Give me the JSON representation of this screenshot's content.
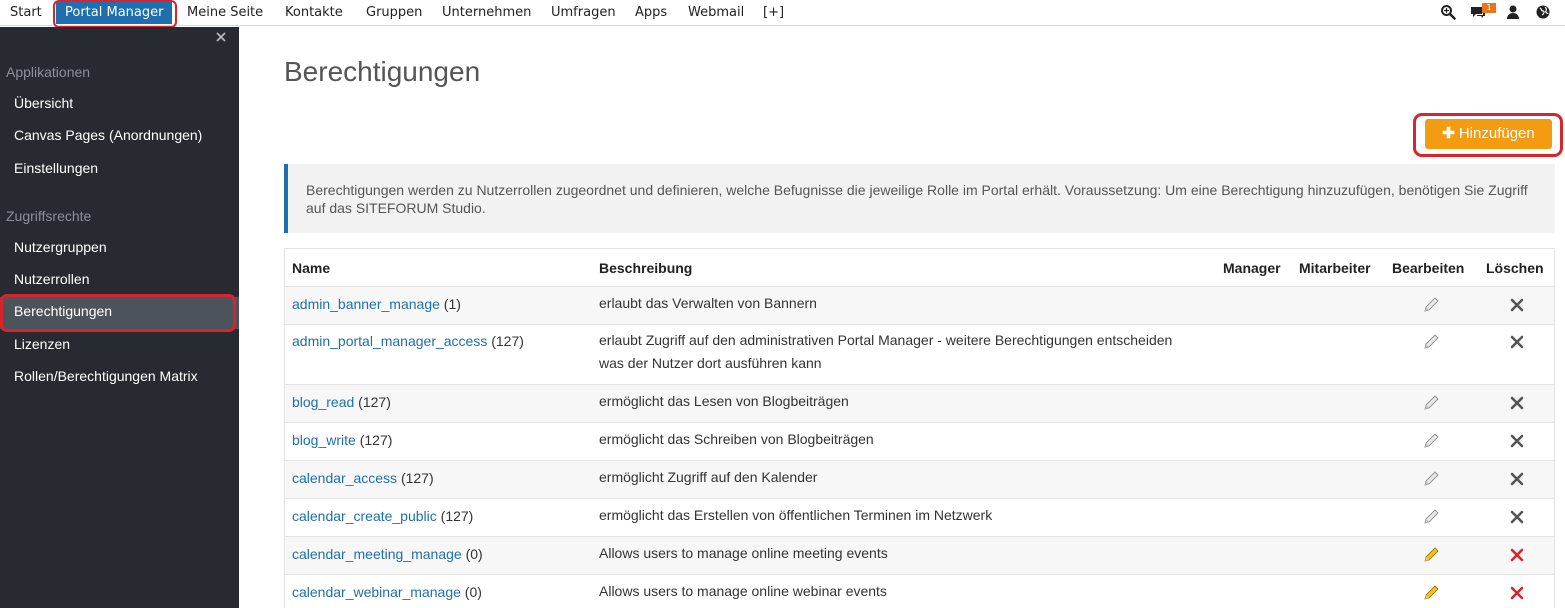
{
  "topnav": {
    "items": [
      {
        "label": "Start"
      },
      {
        "label": "Portal Manager"
      },
      {
        "label": "Meine Seite"
      },
      {
        "label": "Kontakte"
      },
      {
        "label": "Gruppen"
      },
      {
        "label": "Unternehmen"
      },
      {
        "label": "Umfragen"
      },
      {
        "label": "Apps"
      },
      {
        "label": "Webmail"
      },
      {
        "label": "[+]"
      }
    ],
    "active_index": 1,
    "notification_count": "1",
    "icons": [
      "search-icon",
      "chat-icon",
      "user-icon",
      "globe-icon"
    ]
  },
  "sidebar": {
    "sections": [
      {
        "label": "Applikationen"
      },
      {
        "label": "Zugriffsrechte"
      }
    ],
    "items": [
      {
        "label": "Übersicht"
      },
      {
        "label": "Canvas Pages (Anordnungen)"
      },
      {
        "label": "Einstellungen"
      },
      {
        "label": "Nutzergruppen"
      },
      {
        "label": "Nutzerrollen"
      },
      {
        "label": "Berechtigungen"
      },
      {
        "label": "Lizenzen"
      },
      {
        "label": "Rollen/Berechtigungen Matrix"
      }
    ],
    "active_item": "Berechtigungen"
  },
  "main": {
    "title": "Berechtigungen",
    "add_button": "Hinzufügen",
    "info": "Berechtigungen werden zu Nutzerrollen zugeordnet und definieren, welche Befugnisse die jeweilige Rolle im Portal erhält. Voraussetzung: Um eine Berechtigung hinzuzufügen, benötigen Sie Zugriff auf das SITEFORUM Studio.",
    "columns": {
      "name": "Name",
      "description": "Beschreibung",
      "manager": "Manager",
      "mitarbeiter": "Mitarbeiter",
      "edit": "Bearbeiten",
      "delete": "Löschen"
    },
    "rows": [
      {
        "name": "admin_banner_manage",
        "count": " (1)",
        "description": "erlaubt das Verwalten von Bannern",
        "active": false
      },
      {
        "name": "admin_portal_manager_access",
        "count": " (127)",
        "description": "erlaubt Zugriff auf den administrativen Portal Manager - weitere Berechtigungen entscheiden was der Nutzer dort ausführen kann",
        "active": false
      },
      {
        "name": "blog_read",
        "count": " (127)",
        "description": "ermöglicht das Lesen von Blogbeiträgen",
        "active": false
      },
      {
        "name": "blog_write",
        "count": " (127)",
        "description": "ermöglicht das Schreiben von Blogbeiträgen",
        "active": false
      },
      {
        "name": "calendar_access",
        "count": " (127)",
        "description": "ermöglicht Zugriff auf den Kalender",
        "active": false
      },
      {
        "name": "calendar_create_public",
        "count": " (127)",
        "description": "ermöglicht das Erstellen von öffentlichen Terminen im Netzwerk",
        "active": false
      },
      {
        "name": "calendar_meeting_manage",
        "count": " (0)",
        "description": "Allows users to manage online meeting events",
        "active": true
      },
      {
        "name": "calendar_webinar_manage",
        "count": " (0)",
        "description": "Allows users to manage online webinar events",
        "active": true
      }
    ]
  },
  "colors": {
    "nav_active": "#1f6fae",
    "sidebar_bg": "#272b31",
    "add_button": "#f39c12",
    "highlight": "#d9232d",
    "link": "#1f6fae"
  }
}
